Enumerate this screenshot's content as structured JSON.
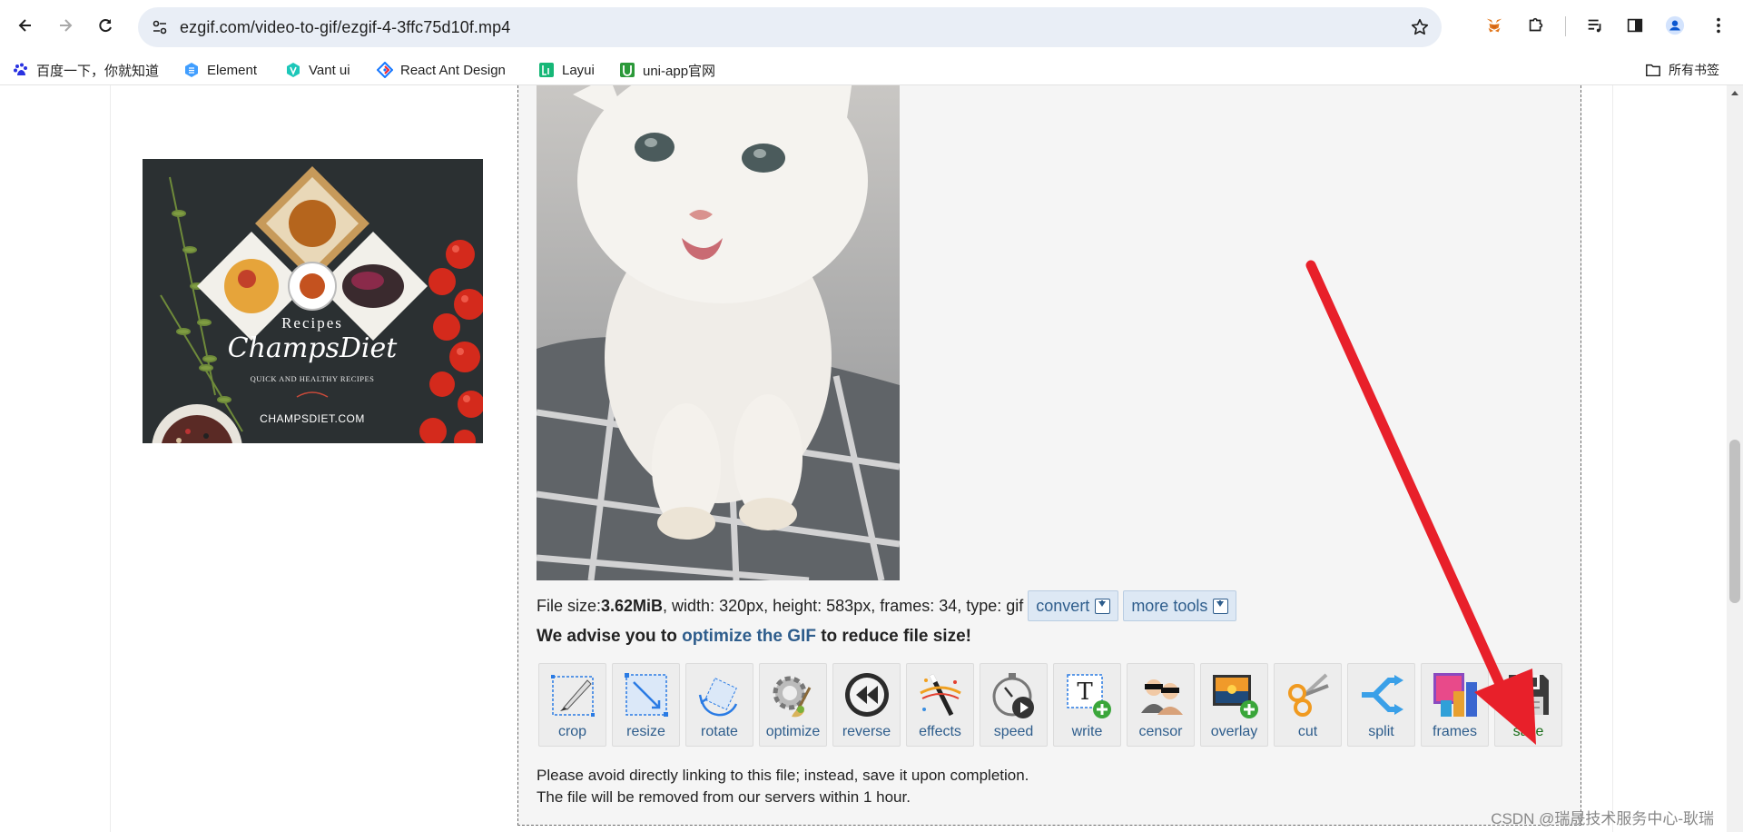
{
  "browser": {
    "url": "ezgif.com/video-to-gif/ezgif-4-3ffc75d10f.mp4",
    "bookmarks": [
      {
        "label": "百度一下，你就知道",
        "icon": "baidu-icon"
      },
      {
        "label": "Element",
        "icon": "element-icon"
      },
      {
        "label": "Vant ui",
        "icon": "vant-icon"
      },
      {
        "label": "React Ant Design",
        "icon": "antd-icon"
      },
      {
        "label": "Layui",
        "icon": "layui-icon"
      },
      {
        "label": "uni-app官网",
        "icon": "uniapp-icon"
      }
    ],
    "all_bookmarks_label": "所有书签"
  },
  "ad": {
    "brand_line1": "Recipes",
    "brand_line2": "ChampsDiet",
    "tagline": "QUICK AND HEALTHY RECIPES",
    "site": "CHAMPSDIET.COM"
  },
  "file_info": {
    "prefix": "File size: ",
    "size": "3.62MiB",
    "rest": ", width: 320px, height: 583px, frames: 34, type: gif",
    "convert_label": "convert",
    "more_tools_label": "more tools"
  },
  "advise": {
    "before": "We advise you to ",
    "link": "optimize the GIF",
    "after": " to reduce file size!"
  },
  "tools": [
    {
      "label": "crop",
      "icon": "crop-icon"
    },
    {
      "label": "resize",
      "icon": "resize-icon"
    },
    {
      "label": "rotate",
      "icon": "rotate-icon"
    },
    {
      "label": "optimize",
      "icon": "optimize-icon"
    },
    {
      "label": "reverse",
      "icon": "reverse-icon"
    },
    {
      "label": "effects",
      "icon": "effects-icon"
    },
    {
      "label": "speed",
      "icon": "speed-icon"
    },
    {
      "label": "write",
      "icon": "write-icon"
    },
    {
      "label": "censor",
      "icon": "censor-icon"
    },
    {
      "label": "overlay",
      "icon": "overlay-icon"
    },
    {
      "label": "cut",
      "icon": "cut-icon"
    },
    {
      "label": "split",
      "icon": "split-icon"
    },
    {
      "label": "frames",
      "icon": "frames-icon"
    },
    {
      "label": "save",
      "icon": "save-icon"
    }
  ],
  "notice": {
    "line1": "Please avoid directly linking to this file; instead, save it upon completion.",
    "line2": "The file will be removed from our servers within 1 hour."
  },
  "watermark": "CSDN @瑞晟技术服务中心-耿瑞",
  "colors": {
    "link": "#2e5d8c",
    "save_label": "#176b17",
    "annotation_arrow": "#e8202a",
    "panel_bg": "#f5f5f5"
  }
}
